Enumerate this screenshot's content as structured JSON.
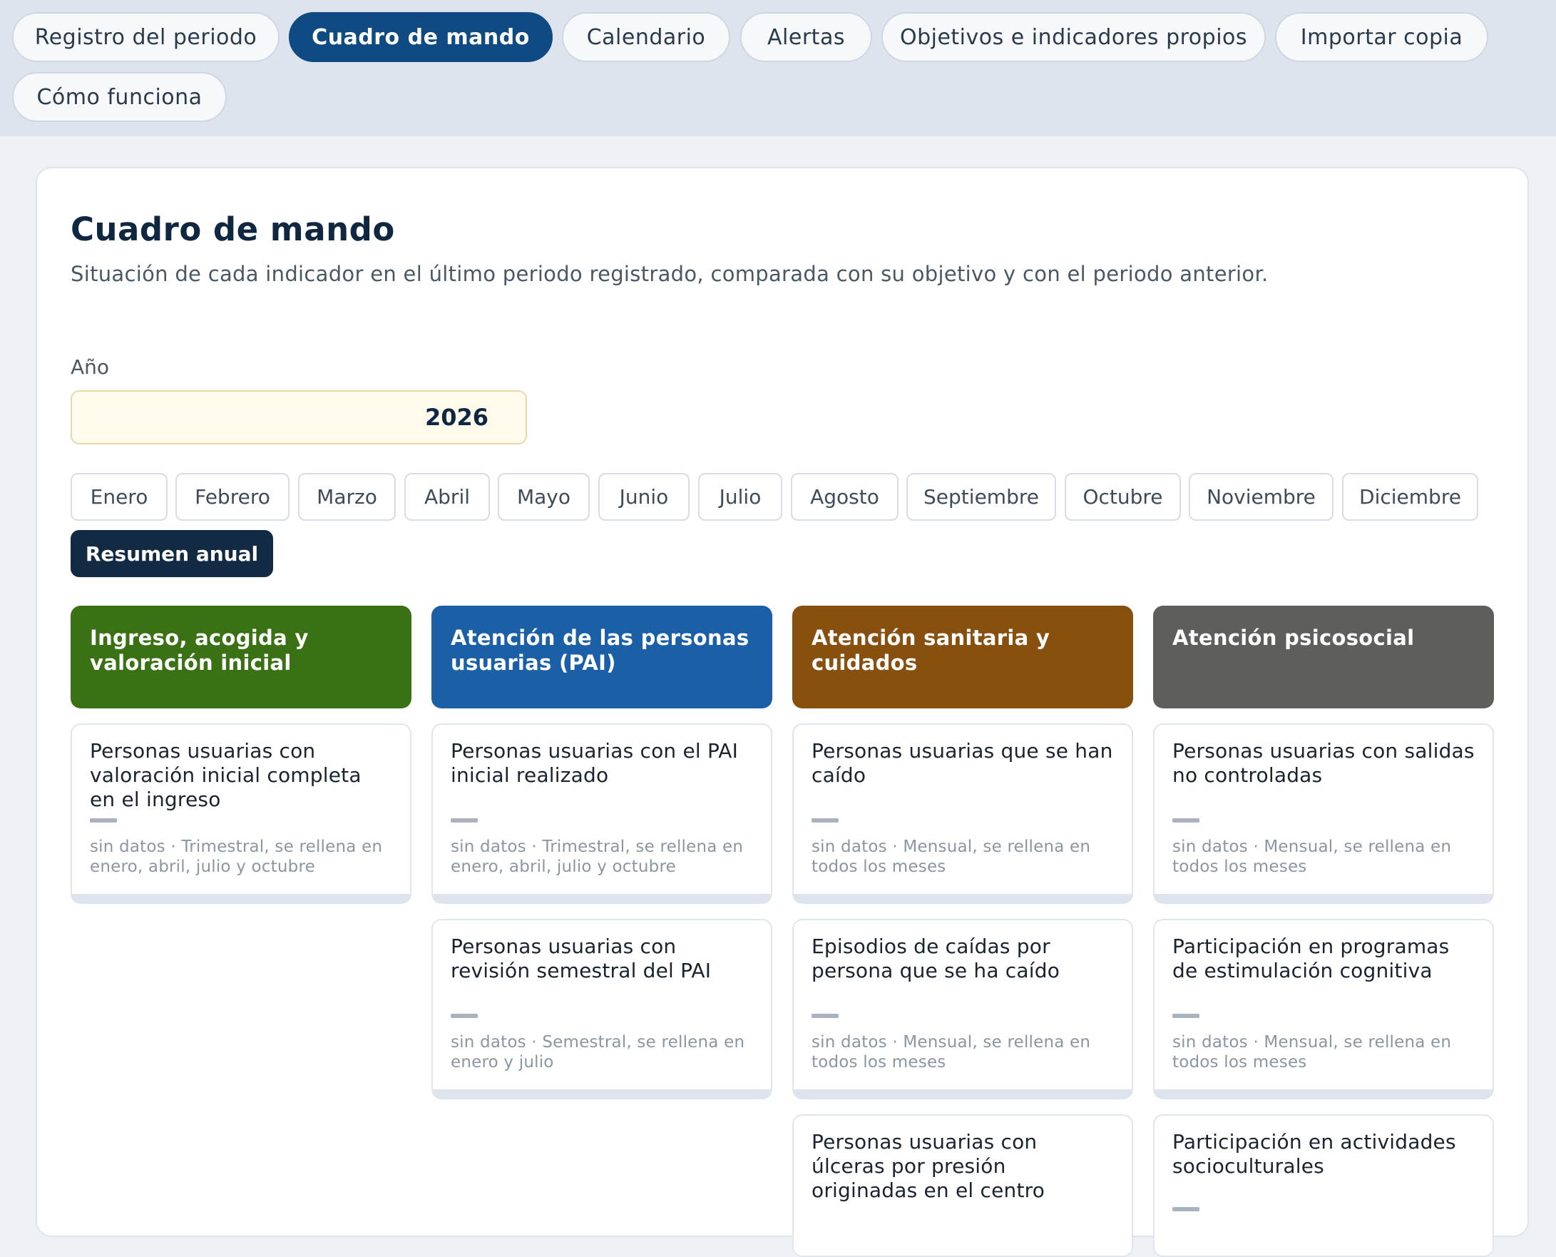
{
  "nav": {
    "tabs": [
      {
        "label": "Registro del periodo"
      },
      {
        "label": "Cuadro de mando"
      },
      {
        "label": "Calendario"
      },
      {
        "label": "Alertas"
      },
      {
        "label": "Objetivos e indicadores propios"
      },
      {
        "label": "Importar copia"
      },
      {
        "label": "Cómo funciona"
      }
    ],
    "active": "Cuadro de mando"
  },
  "page": {
    "title": "Cuadro de mando",
    "subtitle": "Situación de cada indicador en el último periodo registrado, comparada con su objetivo y con el periodo anterior."
  },
  "year": {
    "label": "Año",
    "value": "2026"
  },
  "months": [
    "Enero",
    "Febrero",
    "Marzo",
    "Abril",
    "Mayo",
    "Junio",
    "Julio",
    "Agosto",
    "Septiembre",
    "Octubre",
    "Noviembre",
    "Diciembre"
  ],
  "annual_button": "Resumen anual",
  "colors": {
    "active_tab": "#0f4a82",
    "annual_button": "#132a45",
    "col_ingreso": "#3b7115",
    "col_pai": "#1b5fa7",
    "col_sanitaria": "#87500f",
    "col_psicosocial": "#5e5e5c"
  },
  "columns": [
    {
      "title": "Ingreso, acogida y valoración inicial",
      "indicators": [
        {
          "title": "Personas usuarias con valoración inicial completa en el ingreso",
          "value": "—",
          "meta": "sin datos · Trimestral, se rellena en enero, abril, julio y octubre"
        }
      ]
    },
    {
      "title": "Atención de las personas usuarias (PAI)",
      "indicators": [
        {
          "title": "Personas usuarias con el PAI inicial realizado",
          "value": "—",
          "meta": "sin datos · Trimestral, se rellena en enero, abril, julio y octubre"
        },
        {
          "title": "Personas usuarias con revisión semestral del PAI",
          "value": "—",
          "meta": "sin datos · Semestral, se rellena en enero y julio"
        }
      ]
    },
    {
      "title": "Atención sanitaria y cuidados",
      "indicators": [
        {
          "title": "Personas usuarias que se han caído",
          "value": "—",
          "meta": "sin datos · Mensual, se rellena en todos los meses"
        },
        {
          "title": "Episodios de caídas por persona que se ha caído",
          "value": "—",
          "meta": "sin datos · Mensual, se rellena en todos los meses"
        },
        {
          "title": "Personas usuarias con úlceras por presión originadas en el centro",
          "value": "",
          "meta": ""
        }
      ]
    },
    {
      "title": "Atención psicosocial",
      "indicators": [
        {
          "title": "Personas usuarias con salidas no controladas",
          "value": "—",
          "meta": "sin datos · Mensual, se rellena en todos los meses"
        },
        {
          "title": "Participación en programas de estimulación cognitiva",
          "value": "—",
          "meta": "sin datos · Mensual, se rellena en todos los meses"
        },
        {
          "title": "Participación en actividades socioculturales",
          "value": "—",
          "meta": ""
        }
      ]
    }
  ]
}
